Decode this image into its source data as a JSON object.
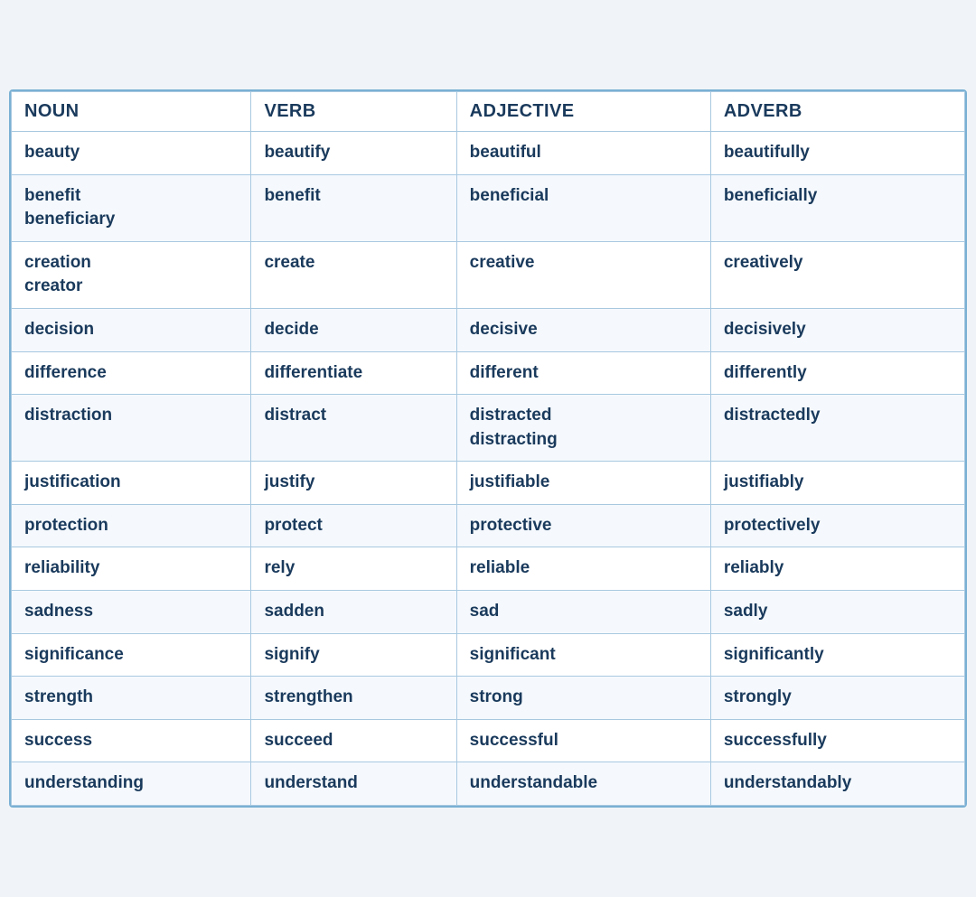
{
  "table": {
    "headers": [
      "NOUN",
      "VERB",
      "ADJECTIVE",
      "ADVERB"
    ],
    "rows": [
      {
        "noun": "beauty",
        "verb": "beautify",
        "adjective": "beautiful",
        "adverb": "beautifully"
      },
      {
        "noun": "benefit\nbeneficiary",
        "verb": "benefit",
        "adjective": "beneficial",
        "adverb": "beneficially"
      },
      {
        "noun": "creation\ncreator",
        "verb": "create",
        "adjective": "creative",
        "adverb": "creatively"
      },
      {
        "noun": "decision",
        "verb": "decide",
        "adjective": "decisive",
        "adverb": "decisively"
      },
      {
        "noun": "difference",
        "verb": "differentiate",
        "adjective": "different",
        "adverb": "differently"
      },
      {
        "noun": "distraction",
        "verb": "distract",
        "adjective": "distracted\ndistracting",
        "adverb": "distractedly"
      },
      {
        "noun": "justification",
        "verb": "justify",
        "adjective": "justifiable",
        "adverb": "justifiably"
      },
      {
        "noun": "protection",
        "verb": "protect",
        "adjective": "protective",
        "adverb": "protectively"
      },
      {
        "noun": "reliability",
        "verb": "rely",
        "adjective": "reliable",
        "adverb": "reliably"
      },
      {
        "noun": "sadness",
        "verb": "sadden",
        "adjective": "sad",
        "adverb": "sadly"
      },
      {
        "noun": "significance",
        "verb": "signify",
        "adjective": "significant",
        "adverb": "significantly"
      },
      {
        "noun": "strength",
        "verb": "strengthen",
        "adjective": "strong",
        "adverb": "strongly"
      },
      {
        "noun": "success",
        "verb": "succeed",
        "adjective": "successful",
        "adverb": "successfully"
      },
      {
        "noun": "understanding",
        "verb": "understand",
        "adjective": "understandable",
        "adverb": "understandably"
      }
    ]
  }
}
